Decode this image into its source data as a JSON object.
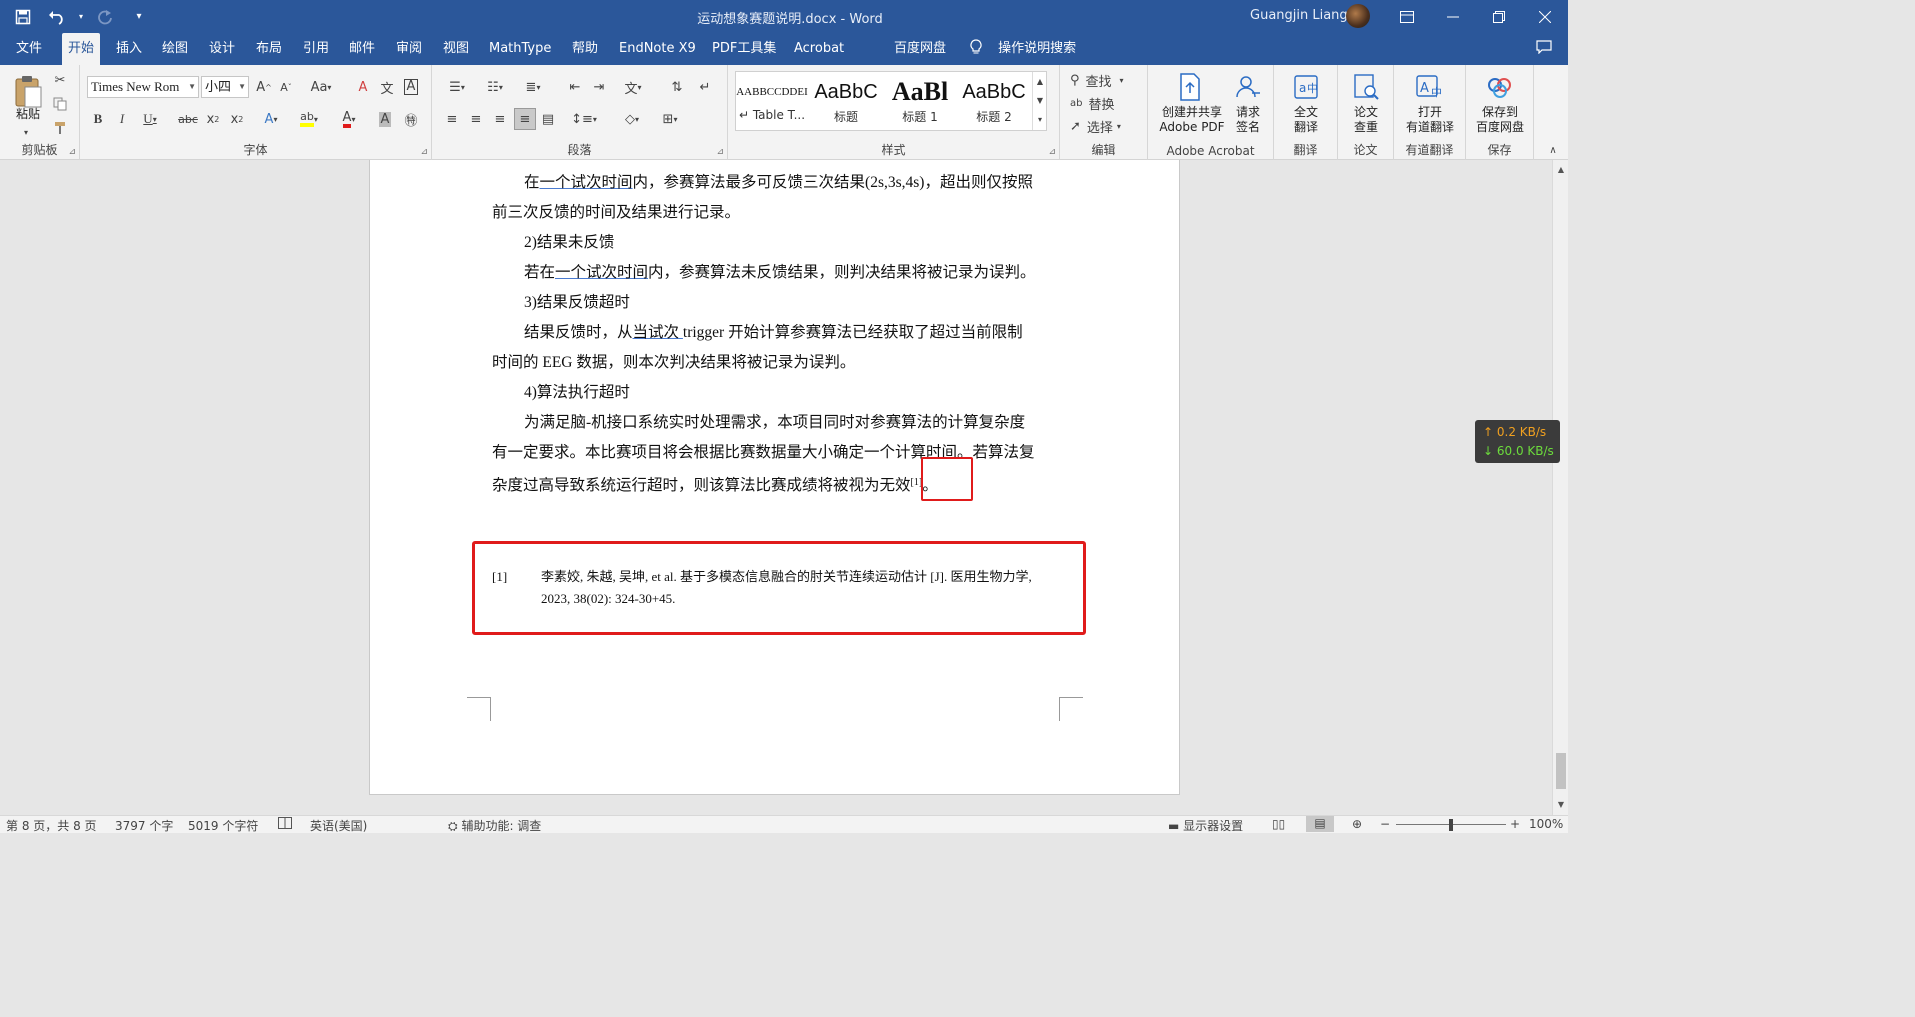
{
  "titlebar": {
    "doc_title": "运动想象赛题说明.docx  -  Word",
    "user_name": "Guangjin Liang",
    "qat_icons": [
      "save-icon",
      "undo-icon",
      "redo-icon",
      "customize-icon"
    ]
  },
  "tabs": [
    "文件",
    "开始",
    "插入",
    "绘图",
    "设计",
    "布局",
    "引用",
    "邮件",
    "审阅",
    "视图",
    "MathType",
    "帮助",
    "EndNote X9",
    "PDF工具集",
    "Acrobat",
    "百度网盘"
  ],
  "active_tab": "开始",
  "tell_me": "操作说明搜索",
  "ribbon": {
    "clipboard": {
      "paste": "粘贴",
      "label": "剪贴板"
    },
    "font": {
      "name": "Times New Rom",
      "size": "小四",
      "label": "字体"
    },
    "paragraph": {
      "label": "段落"
    },
    "styles": {
      "label": "样式",
      "items": [
        {
          "sample": "AABBCCDDEI",
          "name": "↵ Table T..."
        },
        {
          "sample": "AaBbC",
          "name": "标题"
        },
        {
          "sample": "AaBl",
          "name": "标题 1"
        },
        {
          "sample": "AaBbC",
          "name": "标题 2"
        }
      ]
    },
    "editing": {
      "find": "查找",
      "replace": "替换",
      "select": "选择",
      "label": "编辑"
    },
    "acrobat": {
      "create_pdf_line1": "创建并共享",
      "create_pdf_line2": "Adobe PDF",
      "sign_line1": "请求",
      "sign_line2": "签名",
      "label": "Adobe Acrobat"
    },
    "translate": {
      "full_line1": "全文",
      "full_line2": "翻译",
      "label": "翻译"
    },
    "paper": {
      "check_line1": "论文",
      "check_line2": "查重",
      "label": "论文"
    },
    "youdao": {
      "open_line1": "打开",
      "open_line2": "有道翻译",
      "label": "有道翻译"
    },
    "save": {
      "baidu_line1": "保存到",
      "baidu_line2": "百度网盘",
      "label": "保存"
    }
  },
  "document": {
    "p1_a": "在",
    "p1_u": "一个试次时间",
    "p1_b": "内，参赛算法最多可反馈三次结果(2s,3s,4s)，超出则仅按照",
    "p2": "前三次反馈的时间及结果进行记录。",
    "h2": "2)结果未反馈",
    "p3_a": "若在",
    "p3_u": "一个试次时间",
    "p3_b": "内，参赛算法未反馈结果，则判决结果将被记录为误判。",
    "h3": "3)结果反馈超时",
    "p4_a": "结果反馈时，从",
    "p4_u": "当试次 ",
    "p4_b": "trigger 开始计算参赛算法已经获取了超过当前限制",
    "p5": "时间的 EEG 数据，则本次判决结果将被记录为误判。",
    "h4": "4)算法执行超时",
    "p6": "为满足脑-机接口系统实时处理需求，本项目同时对参赛算法的计算复杂度",
    "p7": "有一定要求。本比赛项目将会根据比赛数据量大小确定一个计算时间。若算法复",
    "p8_a": "杂度过高导致系统运行超时，则该算法比赛成绩将被视为无效",
    "p8_ref": "[1]",
    "p8_b": "。",
    "footnote_num": "[1]",
    "footnote_text": "李素姣, 朱越, 吴坤, et al. 基于多模态信息融合的肘关节连续运动估计 [J]. 医用生物力学, 2023, 38(02): 324-30+45."
  },
  "netspeed": {
    "up": "↑ 0.2 KB/s",
    "down": "↓ 60.0 KB/s"
  },
  "status": {
    "page": "第 8 页，共 8 页",
    "words": "3797 个字",
    "chars": "5019 个字符",
    "language": "英语(美国)",
    "accessibility": "辅助功能: 调查",
    "display": "显示器设置",
    "zoom": "100%"
  }
}
